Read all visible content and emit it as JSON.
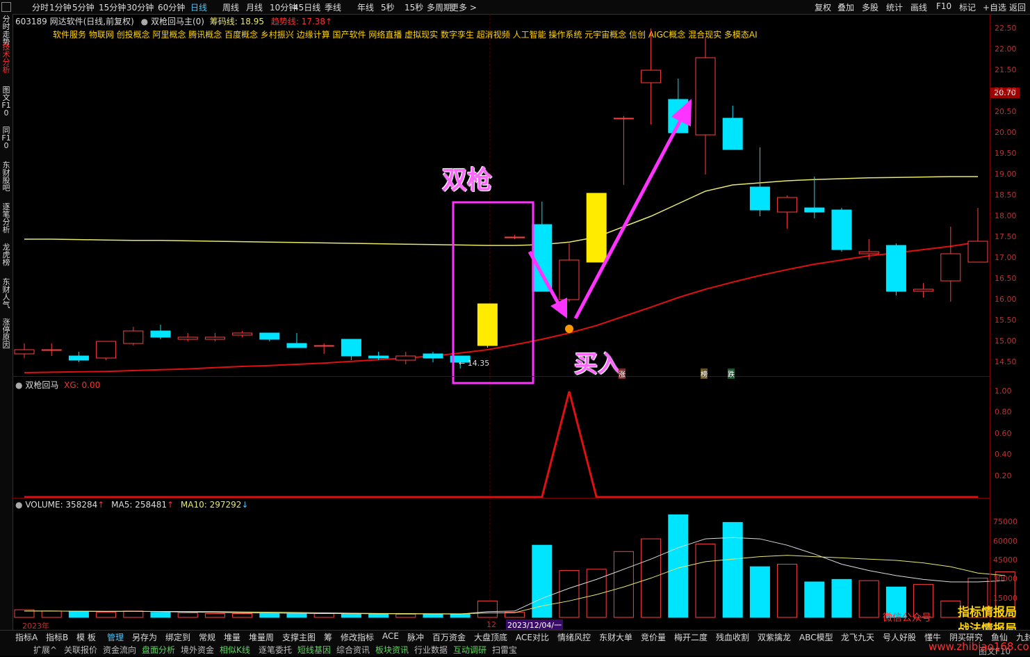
{
  "top_toolbar": {
    "periods": [
      "分时",
      "1分钟",
      "5分钟",
      "15分钟",
      "30分钟",
      "60分钟",
      "日线",
      "周线",
      "月线",
      "10分钟",
      "45日线",
      "季线",
      "年线",
      "5秒",
      "15秒",
      "多周期",
      "更多 >"
    ],
    "active_period": "日线",
    "right_tools": [
      "复权",
      "叠加",
      "多股",
      "统计",
      "画线",
      "F10",
      "标记",
      "+自选",
      "返回"
    ]
  },
  "sidebar_tabs": [
    "分时走势",
    "技术分析",
    "图文F10",
    "同F10",
    "东财股吧",
    "逐笔分析",
    "龙虎榜",
    "东财人气",
    "涨停原因"
  ],
  "header": {
    "stock": "603189 网达软件(日线,前复权)",
    "indicator": "双枪回马主(0)",
    "chip_label": "筹码线: 18.95",
    "trend_label": "趋势线: 17.38"
  },
  "concepts": "软件服务  物联网 创投概念 阿里概念 腾讯概念 百度概念 乡村振兴 边缘计算 国产软件 网络直播 虚拟现实 数字孪生 超清视频 人工智能 操作系统 元宇宙概念 信创 AIGC概念 混合现实 多模态AI",
  "annotations": {
    "double_gun": "双枪",
    "buy": "买入",
    "low_price": "← 14.35",
    "current_price_tag": "20.70",
    "tag_zhang": "涨",
    "tag_bang": "榜",
    "tag_die": "跌"
  },
  "sub_panel": {
    "name": "双枪回马",
    "xg": "XG: 0.00"
  },
  "volume_panel": {
    "volume": "VOLUME: 358284",
    "ma5": "MA5: 258481",
    "ma10": "MA10: 297292"
  },
  "price_axis": [
    "22.50",
    "22.00",
    "21.50",
    "21.00",
    "20.50",
    "20.00",
    "19.50",
    "19.00",
    "18.50",
    "18.00",
    "17.50",
    "17.00",
    "16.50",
    "16.00",
    "15.50",
    "15.00",
    "14.50"
  ],
  "sub_axis": [
    "1.00",
    "0.80",
    "0.60",
    "0.40",
    "0.20"
  ],
  "volume_axis": [
    "75000",
    "60000",
    "45000",
    "30000",
    "15000"
  ],
  "date_labels": {
    "year": "2023年",
    "month": "12",
    "cursor_date": "2023/12/04/一"
  },
  "bottom_toolbar_row1": [
    "指标A",
    "指标B",
    "模 板",
    "管理",
    "另存为",
    "绑定到",
    "常规",
    "堆量",
    "堆量周",
    "支撑主图",
    "筹",
    "修改指标",
    "ACE",
    "脉冲",
    "百万资金",
    "大盘顶底",
    "ACE对比",
    "情绪风控",
    "东财大单",
    "竞价量",
    "梅开二度",
    "残血收割",
    "双紫擒龙",
    "ABC模型",
    "龙飞九天",
    "号人好股",
    "懂牛",
    "阴买研究",
    "鱼仙",
    "九封至尊"
  ],
  "bottom_toolbar_row2": [
    "扩展^",
    "关联报价",
    "资金流向",
    "盘面分析",
    "境外资金",
    "相似K线",
    "逐笔委托",
    "短线基因",
    "综合资讯",
    "板块资讯",
    "行业数据",
    "互动调研",
    "扫雷宝"
  ],
  "bottom_right": "图文F10",
  "watermark": {
    "line1": "微信公众号",
    "line2": "指标情报局",
    "line3": "战法情报局",
    "line4": "www.zhibiao168.com"
  },
  "chart_data": {
    "type": "candlestick",
    "candles": [
      {
        "o": 14.7,
        "c": 14.8,
        "h": 14.95,
        "l": 14.6
      },
      {
        "o": 14.8,
        "c": 14.8,
        "h": 14.95,
        "l": 14.65
      },
      {
        "o": 14.65,
        "c": 14.55,
        "h": 14.75,
        "l": 14.5
      },
      {
        "o": 14.6,
        "c": 15.0,
        "h": 15.0,
        "l": 14.55
      },
      {
        "o": 14.95,
        "c": 15.25,
        "h": 15.35,
        "l": 14.9
      },
      {
        "o": 15.25,
        "c": 15.1,
        "h": 15.4,
        "l": 15.05
      },
      {
        "o": 15.05,
        "c": 15.1,
        "h": 15.2,
        "l": 15.0
      },
      {
        "o": 15.05,
        "c": 15.1,
        "h": 15.2,
        "l": 15.0
      },
      {
        "o": 15.15,
        "c": 15.2,
        "h": 15.25,
        "l": 15.1
      },
      {
        "o": 15.2,
        "c": 15.05,
        "h": 15.2,
        "l": 15.0
      },
      {
        "o": 14.95,
        "c": 14.85,
        "h": 15.2,
        "l": 14.85
      },
      {
        "o": 14.9,
        "c": 14.9,
        "h": 14.95,
        "l": 14.7
      },
      {
        "o": 15.05,
        "c": 14.65,
        "h": 15.05,
        "l": 14.55
      },
      {
        "o": 14.65,
        "c": 14.6,
        "h": 14.75,
        "l": 14.55
      },
      {
        "o": 14.55,
        "c": 14.65,
        "h": 14.75,
        "l": 14.45
      },
      {
        "o": 14.7,
        "c": 14.6,
        "h": 14.75,
        "l": 14.5
      },
      {
        "o": 14.65,
        "c": 14.5,
        "h": 14.65,
        "l": 14.35
      },
      {
        "o": 14.9,
        "c": 15.9,
        "h": 15.9,
        "l": 14.85
      },
      {
        "o": 17.5,
        "c": 17.5,
        "h": 17.55,
        "l": 17.45
      },
      {
        "o": 17.8,
        "c": 16.2,
        "h": 18.35,
        "l": 16.2
      },
      {
        "o": 16.0,
        "c": 16.95,
        "h": 17.35,
        "l": 15.95
      },
      {
        "o": 16.9,
        "c": 18.55,
        "h": 18.55,
        "l": 16.9
      },
      {
        "o": 20.35,
        "c": 20.35,
        "h": 20.4,
        "l": 18.75
      },
      {
        "o": 21.2,
        "c": 21.5,
        "h": 22.5,
        "l": 20.2
      },
      {
        "o": 20.8,
        "c": 20.0,
        "h": 21.3,
        "l": 20.0
      },
      {
        "o": 19.95,
        "c": 21.8,
        "h": 22.3,
        "l": 19.0
      },
      {
        "o": 20.35,
        "c": 19.6,
        "h": 20.65,
        "l": 19.6
      },
      {
        "o": 18.7,
        "c": 18.15,
        "h": 19.65,
        "l": 18.0
      },
      {
        "o": 18.1,
        "c": 18.45,
        "h": 18.5,
        "l": 17.7
      },
      {
        "o": 18.2,
        "c": 18.1,
        "h": 18.95,
        "l": 17.95
      },
      {
        "o": 18.15,
        "c": 17.2,
        "h": 18.2,
        "l": 17.15
      },
      {
        "o": 17.1,
        "c": 17.15,
        "h": 17.45,
        "l": 16.95
      },
      {
        "o": 17.3,
        "c": 16.2,
        "h": 17.35,
        "l": 16.1
      },
      {
        "o": 16.2,
        "c": 16.25,
        "h": 16.4,
        "l": 16.05
      },
      {
        "o": 16.45,
        "c": 17.1,
        "h": 17.75,
        "l": 15.95
      },
      {
        "o": 16.9,
        "c": 17.4,
        "h": 18.2,
        "l": 16.9
      }
    ],
    "ma_yellow": [
      17.45,
      17.45,
      17.44,
      17.43,
      17.42,
      17.42,
      17.41,
      17.4,
      17.39,
      17.38,
      17.37,
      17.36,
      17.35,
      17.34,
      17.33,
      17.32,
      17.31,
      17.3,
      17.3,
      17.32,
      17.38,
      17.5,
      17.75,
      18.0,
      18.3,
      18.6,
      18.75,
      18.8,
      18.85,
      18.88,
      18.9,
      18.92,
      18.93,
      18.94,
      18.95,
      18.95
    ],
    "ma_red": [
      14.25,
      14.26,
      14.27,
      14.28,
      14.3,
      14.32,
      14.34,
      14.37,
      14.4,
      14.42,
      14.45,
      14.48,
      14.52,
      14.56,
      14.6,
      14.65,
      14.72,
      14.8,
      14.92,
      15.05,
      15.2,
      15.38,
      15.6,
      15.82,
      16.05,
      16.25,
      16.42,
      16.58,
      16.72,
      16.85,
      16.95,
      17.05,
      17.12,
      17.2,
      17.28,
      17.38
    ],
    "xg_signal": [
      0,
      0,
      0,
      0,
      0,
      0,
      0,
      0,
      0,
      0,
      0,
      0,
      0,
      0,
      0,
      0,
      0,
      0,
      0,
      0,
      1,
      0,
      0,
      0,
      0,
      0,
      0,
      0,
      0,
      0,
      0,
      0,
      0,
      0,
      0,
      0
    ],
    "volume": [
      6000,
      5000,
      4500,
      4000,
      5000,
      4000,
      3500,
      3000,
      3000,
      3000,
      3000,
      3000,
      3000,
      2500,
      2500,
      2500,
      2500,
      13000,
      4000,
      57000,
      37000,
      38000,
      52000,
      62000,
      81000,
      58000,
      75000,
      40000,
      42000,
      28000,
      30000,
      29000,
      24000,
      26000,
      13000,
      31000,
      36000
    ],
    "vol_ma5": [
      5000,
      5000,
      4800,
      4700,
      4800,
      4500,
      4200,
      4000,
      3600,
      3400,
      3200,
      3000,
      3000,
      2800,
      2800,
      2700,
      2600,
      4500,
      5000,
      15000,
      23000,
      30000,
      38000,
      46000,
      55000,
      62000,
      63000,
      62000,
      57000,
      50000,
      42000,
      37000,
      33000,
      30000,
      28000,
      28000,
      29000
    ],
    "vol_ma10": [
      5000,
      5000,
      4900,
      4800,
      4800,
      4700,
      4600,
      4500,
      4300,
      4100,
      3900,
      3600,
      3300,
      3100,
      3000,
      2900,
      2800,
      3500,
      3700,
      9000,
      13000,
      18000,
      24000,
      31000,
      39000,
      44000,
      46000,
      48000,
      49000,
      48000,
      47000,
      46000,
      45000,
      43000,
      40000,
      35000,
      33000
    ],
    "price_ylim": [
      14.1,
      22.6
    ],
    "vol_ylim": [
      0,
      84000
    ]
  }
}
